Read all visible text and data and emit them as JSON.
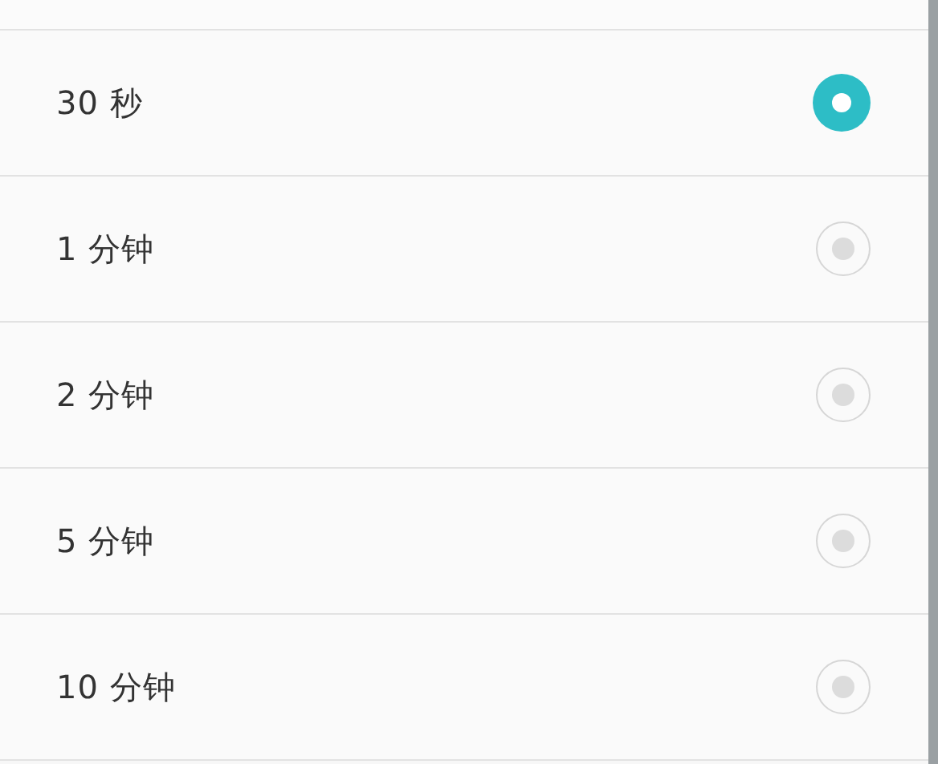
{
  "options": [
    {
      "label": "30 秒",
      "selected": true
    },
    {
      "label": "1 分钟",
      "selected": false
    },
    {
      "label": "2 分钟",
      "selected": false
    },
    {
      "label": "5 分钟",
      "selected": false
    },
    {
      "label": "10 分钟",
      "selected": false
    }
  ]
}
